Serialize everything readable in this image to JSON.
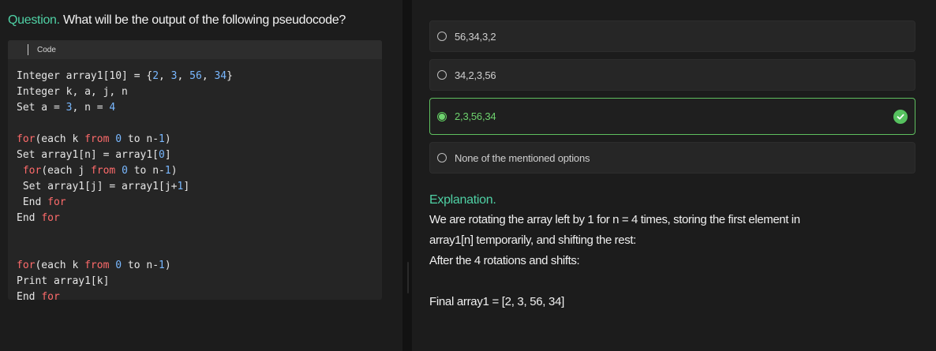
{
  "question": {
    "prefix": "Question.",
    "text": "What will be the output of the following pseudocode?"
  },
  "code": {
    "label": "Code",
    "lines": [
      [
        {
          "t": "Integer array1[10] = {",
          "c": ""
        },
        {
          "t": "2",
          "c": "num"
        },
        {
          "t": ", ",
          "c": ""
        },
        {
          "t": "3",
          "c": "num"
        },
        {
          "t": ", ",
          "c": ""
        },
        {
          "t": "56",
          "c": "num"
        },
        {
          "t": ", ",
          "c": ""
        },
        {
          "t": "34",
          "c": "num"
        },
        {
          "t": "}",
          "c": ""
        }
      ],
      [
        {
          "t": "Integer k, a, j, n",
          "c": ""
        }
      ],
      [
        {
          "t": "Set a = ",
          "c": ""
        },
        {
          "t": "3",
          "c": "num"
        },
        {
          "t": ", n = ",
          "c": ""
        },
        {
          "t": "4",
          "c": "num"
        }
      ],
      [],
      [
        {
          "t": "for",
          "c": "kw"
        },
        {
          "t": "(each k ",
          "c": ""
        },
        {
          "t": "from",
          "c": "kw"
        },
        {
          "t": " ",
          "c": ""
        },
        {
          "t": "0",
          "c": "num"
        },
        {
          "t": " to n-",
          "c": ""
        },
        {
          "t": "1",
          "c": "num"
        },
        {
          "t": ")",
          "c": ""
        }
      ],
      [
        {
          "t": "Set array1[n] = array1[",
          "c": ""
        },
        {
          "t": "0",
          "c": "num"
        },
        {
          "t": "]",
          "c": ""
        }
      ],
      [
        {
          "t": " ",
          "c": ""
        },
        {
          "t": "for",
          "c": "kw"
        },
        {
          "t": "(each j ",
          "c": ""
        },
        {
          "t": "from",
          "c": "kw"
        },
        {
          "t": " ",
          "c": ""
        },
        {
          "t": "0",
          "c": "num"
        },
        {
          "t": " to n-",
          "c": ""
        },
        {
          "t": "1",
          "c": "num"
        },
        {
          "t": ")",
          "c": ""
        }
      ],
      [
        {
          "t": " Set array1[j] = array1[j+",
          "c": ""
        },
        {
          "t": "1",
          "c": "num"
        },
        {
          "t": "]",
          "c": ""
        }
      ],
      [
        {
          "t": " End ",
          "c": ""
        },
        {
          "t": "for",
          "c": "kw"
        }
      ],
      [
        {
          "t": "End ",
          "c": ""
        },
        {
          "t": "for",
          "c": "kw"
        }
      ],
      [],
      [],
      [
        {
          "t": "for",
          "c": "kw"
        },
        {
          "t": "(each k ",
          "c": ""
        },
        {
          "t": "from",
          "c": "kw"
        },
        {
          "t": " ",
          "c": ""
        },
        {
          "t": "0",
          "c": "num"
        },
        {
          "t": " to n-",
          "c": ""
        },
        {
          "t": "1",
          "c": "num"
        },
        {
          "t": ")",
          "c": ""
        }
      ],
      [
        {
          "t": "Print array1[k]",
          "c": ""
        }
      ],
      [
        {
          "t": "End ",
          "c": ""
        },
        {
          "t": "for",
          "c": "kw"
        }
      ]
    ]
  },
  "options": [
    {
      "label": "56,34,3,2",
      "selected": false
    },
    {
      "label": "34,2,3,56",
      "selected": false
    },
    {
      "label": "2,3,56,34",
      "selected": true,
      "correct": true
    },
    {
      "label": "None of the mentioned options",
      "selected": false
    }
  ],
  "explanation": {
    "heading": "Explanation.",
    "line1": "We are rotating the array left by 1 for n = 4 times, storing the first element in",
    "line2": "array1[n] temporarily, and shifting the rest:",
    "line3": "After the 4 rotations and shifts:",
    "final": "Final array1 = [2, 3, 56, 34]"
  },
  "colors": {
    "accent": "#4fd1a5",
    "correct": "#5fbf5f",
    "keyword": "#ff6b6b",
    "number": "#79b8ff"
  },
  "icons": {
    "correct_check": "check-circle-icon"
  }
}
